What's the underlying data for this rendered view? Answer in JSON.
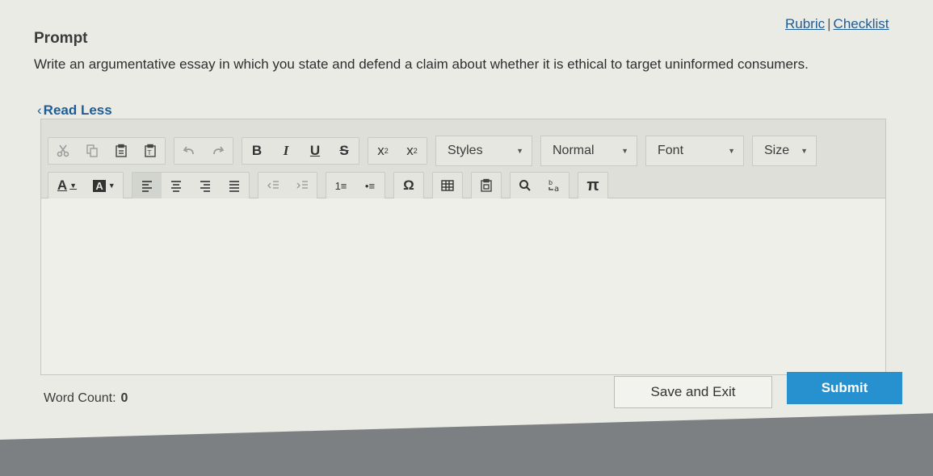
{
  "prompt": {
    "title": "Prompt",
    "links": {
      "rubric": "Rubric",
      "separator": "|",
      "checklist": "Checklist"
    },
    "text": "Write an argumentative essay in which you state and defend a claim about whether it is ethical to target uninformed consumers.",
    "read_less": "Read Less"
  },
  "toolbar": {
    "bold": "B",
    "italic": "I",
    "underline": "U",
    "strike": "S",
    "subscript_base": "x",
    "subscript_index": "2",
    "superscript_base": "x",
    "superscript_index": "2",
    "styles": "Styles",
    "format": "Normal",
    "font": "Font",
    "size": "Size",
    "text_color": "A",
    "bg_color": "A",
    "special_char": "Ω",
    "math": "π",
    "numbered_list": "1≡",
    "bulleted_list": "•≡"
  },
  "footer": {
    "word_count_label": "Word Count:",
    "word_count_value": "0",
    "save_exit": "Save and Exit",
    "submit": "Submit"
  },
  "colors": {
    "link": "#1d5d97",
    "submit": "#2790ce"
  }
}
